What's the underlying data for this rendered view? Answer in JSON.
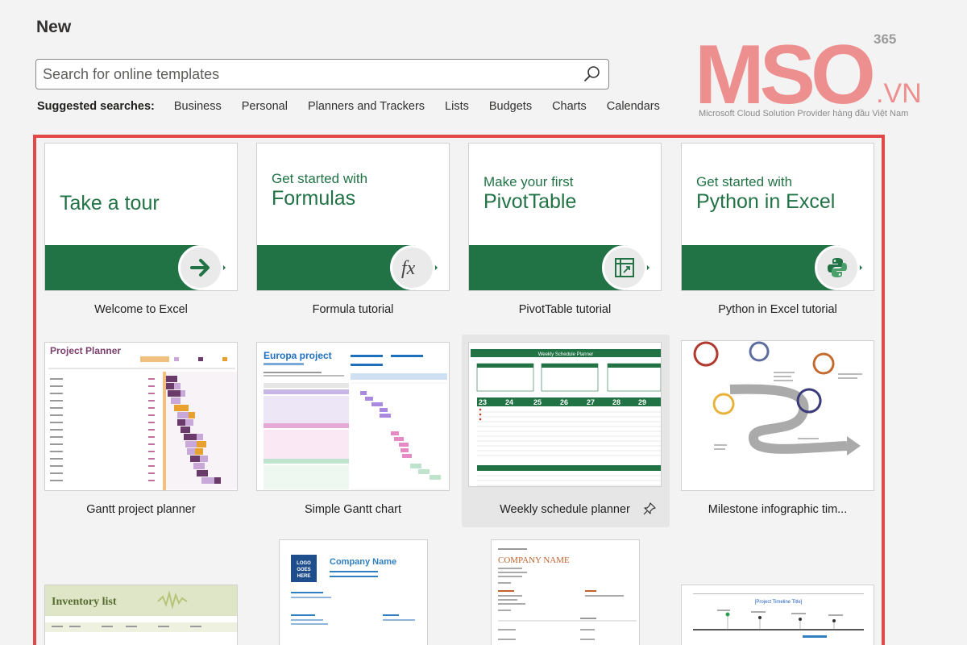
{
  "header": {
    "title": "New"
  },
  "search": {
    "placeholder": "Search for online templates"
  },
  "suggested": {
    "label": "Suggested searches:",
    "items": [
      "Business",
      "Personal",
      "Planners and Trackers",
      "Lists",
      "Budgets",
      "Charts",
      "Calendars"
    ]
  },
  "logo": {
    "brand": "MSO",
    "tld": ".VN",
    "superscript": "365",
    "tagline": "Microsoft Cloud Solution Provider hàng đầu Việt Nam",
    "color": "#ee8f8f"
  },
  "colors": {
    "excel_green": "#217346",
    "highlight_border": "#e24a4a"
  },
  "templates": {
    "row1": [
      {
        "line1": "",
        "line2": "Take a tour",
        "caption": "Welcome to Excel",
        "icon": "arrow-right-icon"
      },
      {
        "line1": "Get started with",
        "line2": "Formulas",
        "caption": "Formula tutorial",
        "icon": "fx-icon"
      },
      {
        "line1": "Make your first",
        "line2": "PivotTable",
        "caption": "PivotTable tutorial",
        "icon": "pivottable-icon"
      },
      {
        "line1": "Get started with",
        "line2": "Python in Excel",
        "caption": "Python in Excel tutorial",
        "icon": "python-icon"
      }
    ],
    "row2": [
      {
        "caption": "Gantt project planner",
        "heading": "Project Planner"
      },
      {
        "caption": "Simple Gantt chart",
        "heading": "Europa project"
      },
      {
        "caption": "Weekly schedule planner",
        "heading": "Weekly Schedule Planner"
      },
      {
        "caption": "Milestone infographic tim..."
      }
    ],
    "row3": [
      {
        "heading": "Inventory list"
      },
      {
        "heading": "Company Name",
        "logo_text": "LOGO GOES HERE"
      },
      {
        "heading": "COMPANY NAME"
      },
      {
        "heading": "[Project Timeline Title]"
      }
    ]
  }
}
